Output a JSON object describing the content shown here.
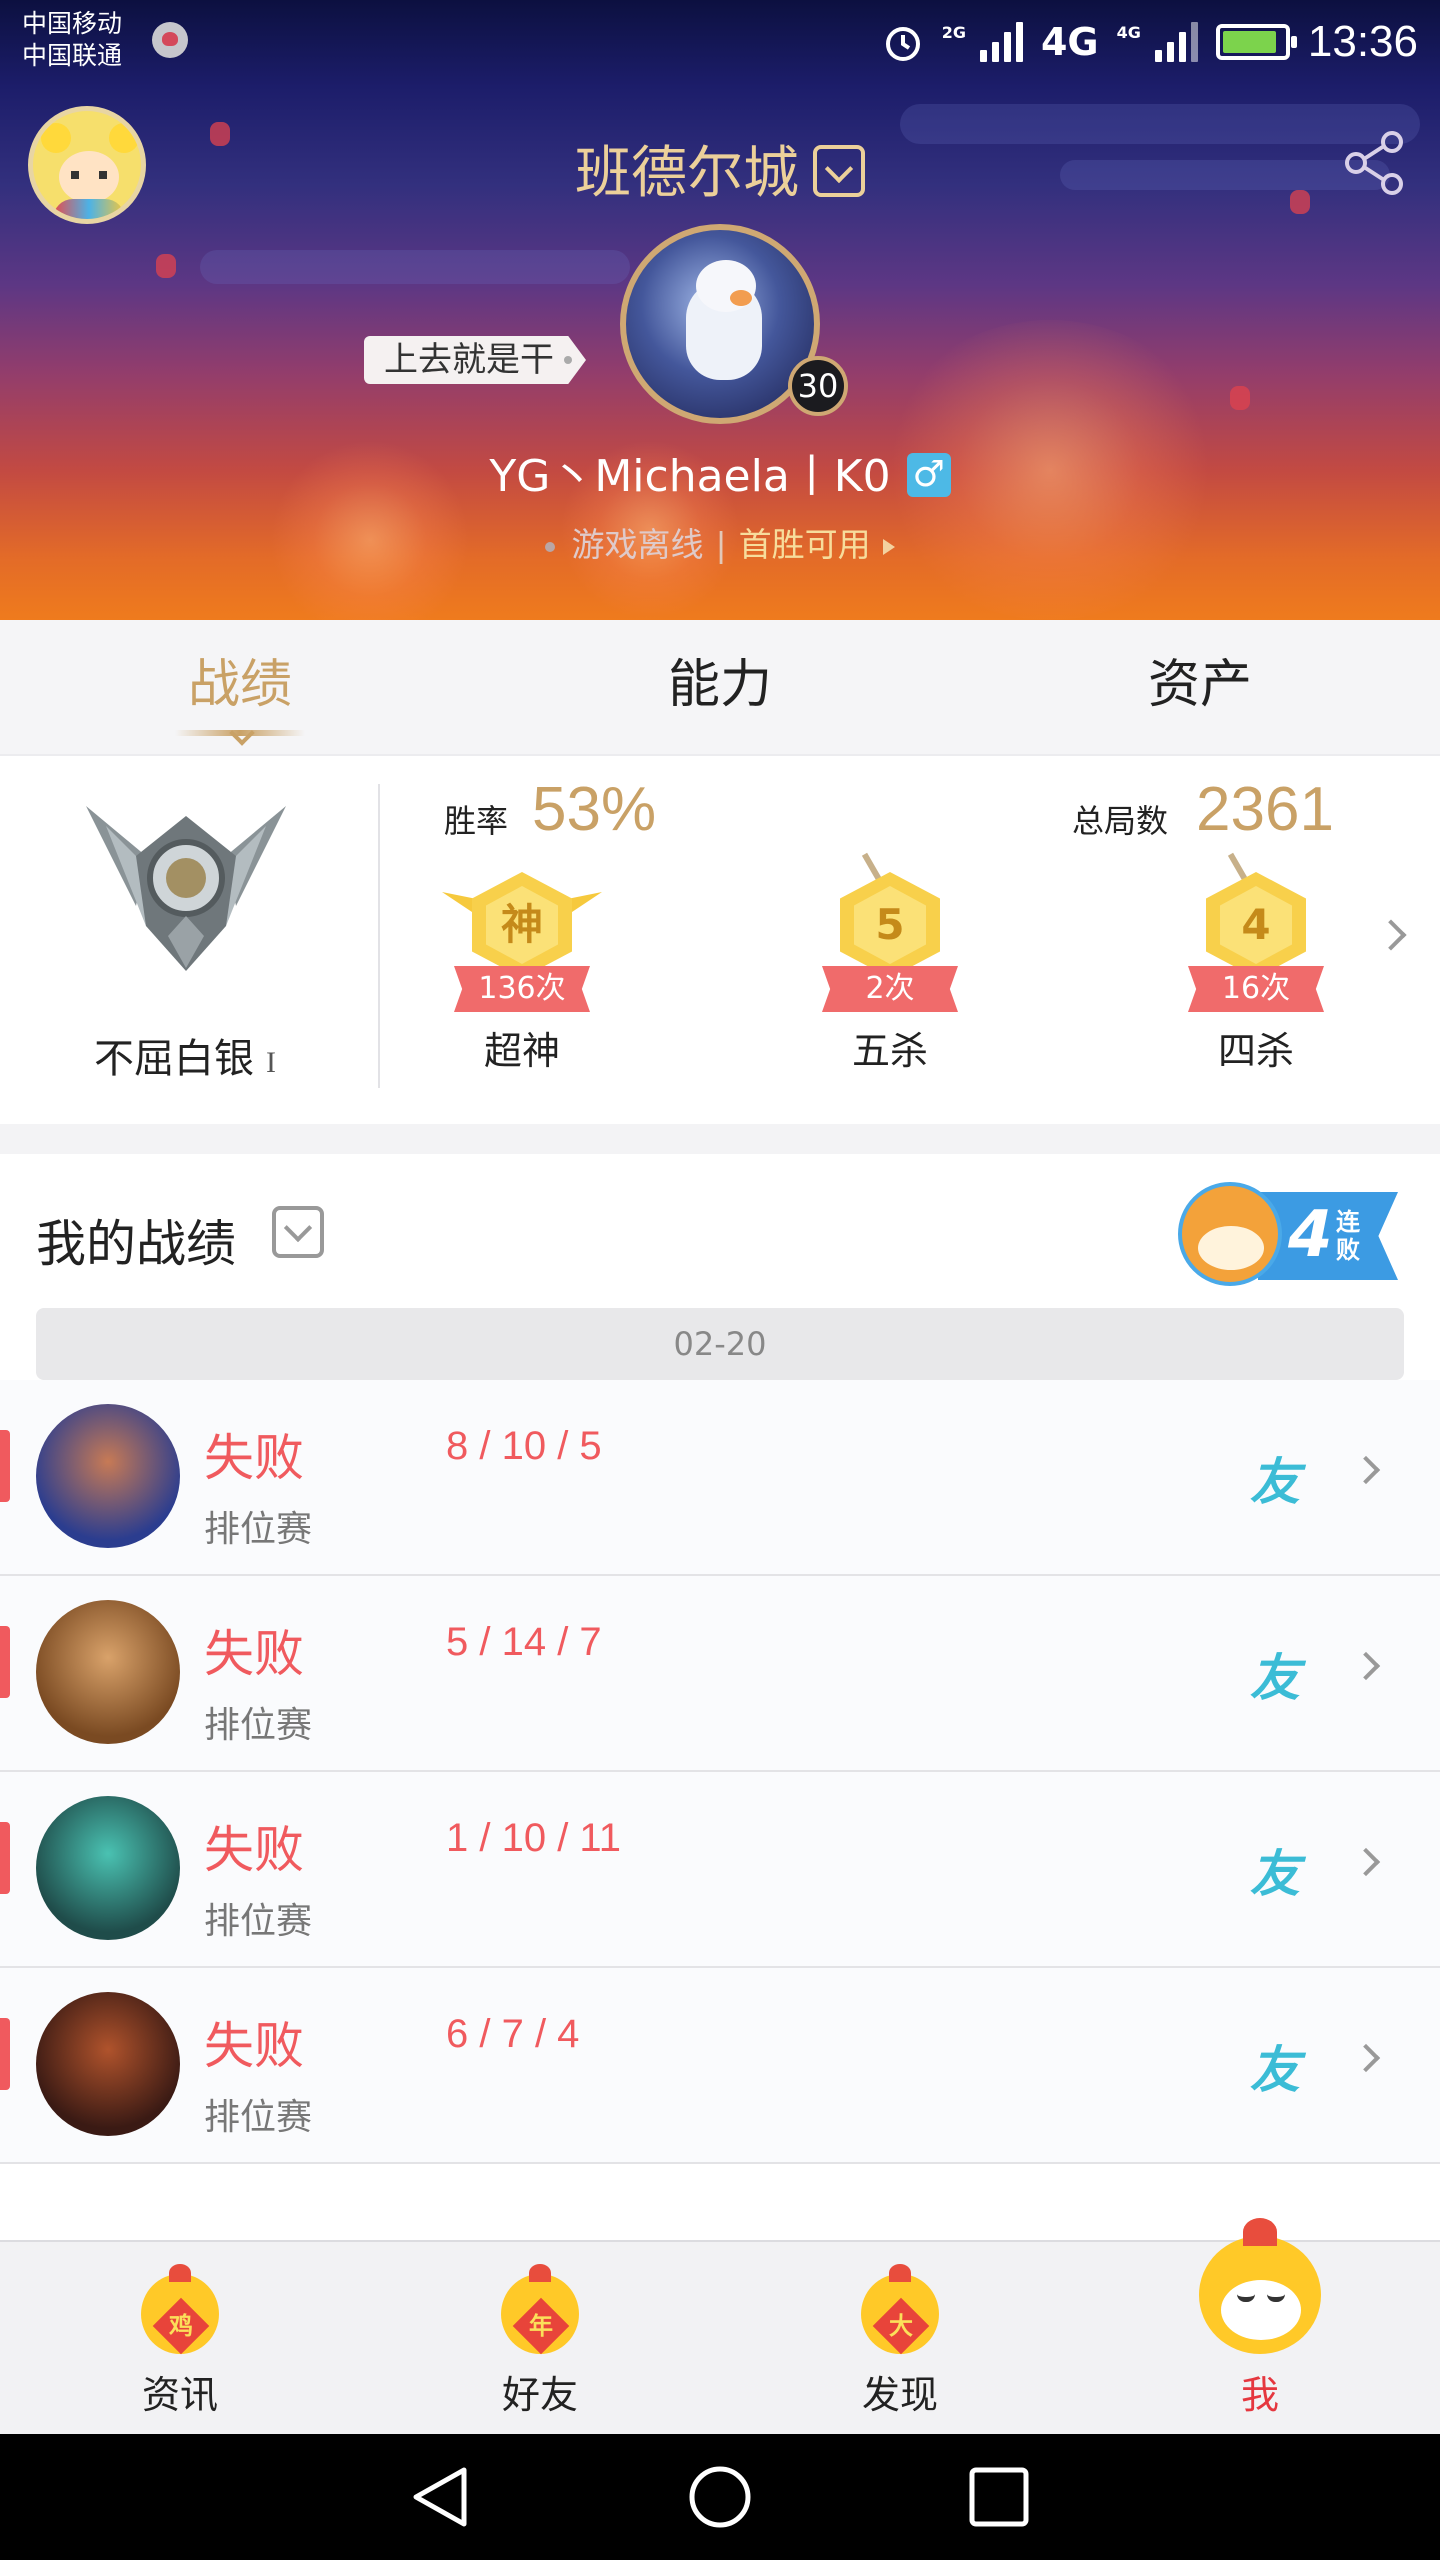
{
  "status_bar": {
    "carrier_1": "中国移动",
    "carrier_2": "中国联通",
    "net_2g": "2G",
    "net_4g": "4G",
    "net_4g_small": "4G",
    "battery_level": 0.85,
    "time": "13:36"
  },
  "header": {
    "server": "班德尔城",
    "motto": "上去就是干",
    "level": "30",
    "nickname": "YG丶Michaela丨K0",
    "gender_symbol": "♂",
    "online_status": "游戏离线",
    "divider": "|",
    "first_win": "首胜可用"
  },
  "tabs": [
    {
      "label": "战绩",
      "active": true
    },
    {
      "label": "能力",
      "active": false
    },
    {
      "label": "资产",
      "active": false
    }
  ],
  "stats": {
    "rank": "不屈白银",
    "rank_tier": "I",
    "win_rate_label": "胜率",
    "win_rate": "53%",
    "total_games_label": "总局数",
    "total_games": "2361",
    "medals": [
      {
        "glyph": "神",
        "count": "136次",
        "label": "超神"
      },
      {
        "glyph": "5",
        "count": "2次",
        "label": "五杀"
      },
      {
        "glyph": "4",
        "count": "16次",
        "label": "四杀"
      }
    ]
  },
  "matches": {
    "title": "我的战绩",
    "streak_number": "4",
    "streak_text": "连败",
    "date": "02-20",
    "rows": [
      {
        "result": "失败",
        "kda": "8 / 10 / 5",
        "mode": "排位赛",
        "friend": "友",
        "colors": [
          "#2b3d8f",
          "#c77a55"
        ]
      },
      {
        "result": "失败",
        "kda": "5 / 14 / 7",
        "mode": "排位赛",
        "friend": "友",
        "colors": [
          "#7a4a22",
          "#d9a26a"
        ]
      },
      {
        "result": "失败",
        "kda": "1 / 10 / 11",
        "mode": "排位赛",
        "friend": "友",
        "colors": [
          "#1f4c4a",
          "#4ac2b2"
        ]
      },
      {
        "result": "失败",
        "kda": "6 / 7 / 4",
        "mode": "排位赛",
        "friend": "友",
        "colors": [
          "#3a1a14",
          "#b0532c"
        ]
      }
    ]
  },
  "bottom_nav": [
    {
      "label": "资讯",
      "glyph": "鸡",
      "active": false
    },
    {
      "label": "好友",
      "glyph": "年",
      "active": false
    },
    {
      "label": "发现",
      "glyph": "大",
      "active": false
    },
    {
      "label": "我",
      "glyph": "",
      "active": true
    }
  ],
  "colors": {
    "accent_gold": "#c9a166",
    "loss_red": "#f05a5e",
    "friend_teal": "#3bbcd6",
    "nav_active": "#e5373f"
  }
}
